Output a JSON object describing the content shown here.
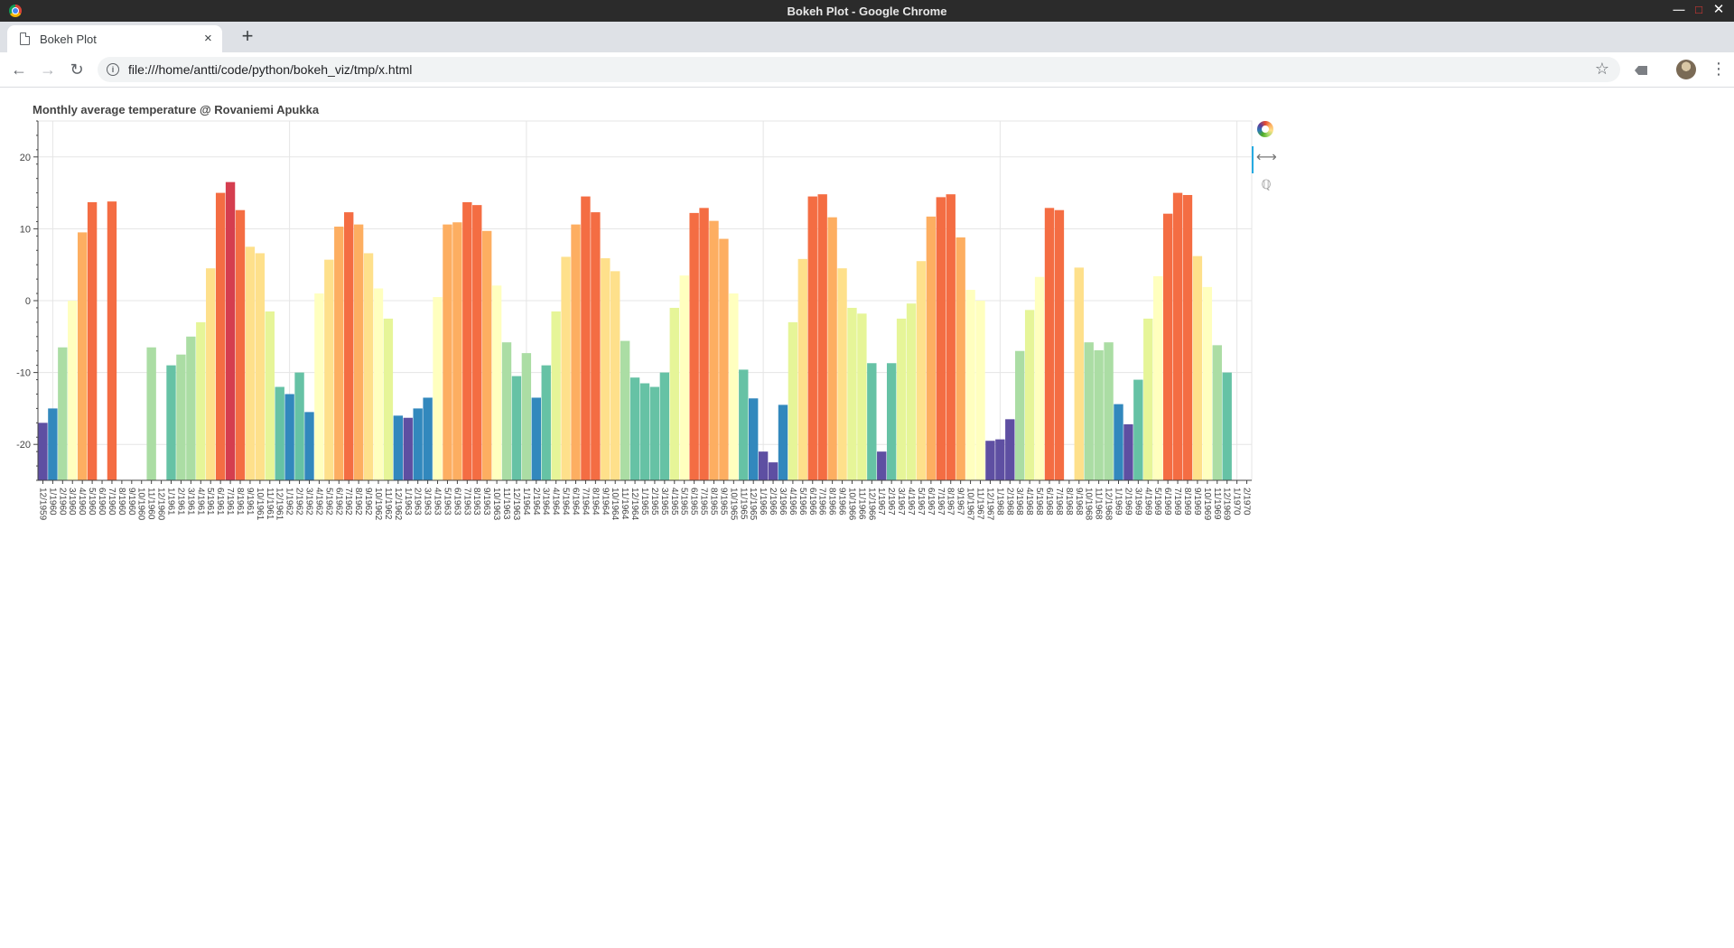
{
  "window": {
    "title": "Bokeh Plot - Google Chrome"
  },
  "tab": {
    "label": "Bokeh Plot",
    "close": "×",
    "new_tab": "+"
  },
  "toolbar": {
    "back": "←",
    "forward": "→",
    "reload": "↻",
    "url": "file:///home/antti/code/python/bokeh_viz/tmp/x.html",
    "info": "i",
    "star": "☆",
    "menu": "⋮"
  },
  "plot_tools": {
    "pan": "⟷",
    "zoom": "ℚ"
  },
  "colors": {
    "palette_spectral": [
      "#5e4fa2",
      "#3288bd",
      "#66c2a5",
      "#abdda4",
      "#e6f598",
      "#ffffbf",
      "#fee08b",
      "#fdae61",
      "#f46d43",
      "#d53e4f"
    ],
    "grid": "#e5e5e5",
    "axis": "#444444"
  },
  "chart_data": {
    "type": "bar",
    "title": "Monthly average temperature @ Rovaniemi Apukka",
    "xlabel": "",
    "ylabel": "",
    "ylim": [
      -25,
      25
    ],
    "y_ticks": [
      -20,
      -10,
      0,
      10,
      20
    ],
    "grid": true,
    "categories": [
      "12/1959",
      "1/1960",
      "2/1960",
      "3/1960",
      "4/1960",
      "5/1960",
      "6/1960",
      "7/1960",
      "8/1960",
      "9/1960",
      "10/1960",
      "11/1960",
      "12/1960",
      "1/1961",
      "2/1961",
      "3/1961",
      "4/1961",
      "5/1961",
      "6/1961",
      "7/1961",
      "8/1961",
      "9/1961",
      "10/1961",
      "11/1961",
      "12/1961",
      "1/1962",
      "2/1962",
      "3/1962",
      "4/1962",
      "5/1962",
      "6/1962",
      "7/1962",
      "8/1962",
      "9/1962",
      "10/1962",
      "11/1962",
      "12/1962",
      "1/1963",
      "2/1963",
      "3/1963",
      "4/1963",
      "5/1963",
      "6/1963",
      "7/1963",
      "8/1963",
      "9/1963",
      "10/1963",
      "11/1963",
      "12/1963",
      "1/1964",
      "2/1964",
      "3/1964",
      "4/1964",
      "5/1964",
      "6/1964",
      "7/1964",
      "8/1964",
      "9/1964",
      "10/1964",
      "11/1964",
      "12/1964",
      "1/1965",
      "2/1965",
      "3/1965",
      "4/1965",
      "5/1965",
      "6/1965",
      "7/1965",
      "8/1965",
      "9/1965",
      "10/1965",
      "11/1965",
      "12/1965",
      "1/1966",
      "2/1966",
      "3/1966",
      "4/1966",
      "5/1966",
      "6/1966",
      "7/1966",
      "8/1966",
      "9/1966",
      "10/1966",
      "11/1966",
      "12/1966",
      "1/1967",
      "2/1967",
      "3/1967",
      "4/1967",
      "5/1967",
      "6/1967",
      "7/1967",
      "8/1967",
      "9/1967",
      "10/1967",
      "11/1967",
      "12/1967",
      "1/1968",
      "2/1968",
      "3/1968",
      "4/1968",
      "5/1968",
      "6/1968",
      "7/1968",
      "8/1968",
      "9/1968",
      "10/1968",
      "11/1968",
      "12/1968",
      "1/1969",
      "2/1969",
      "3/1969",
      "4/1969",
      "5/1969",
      "6/1969",
      "7/1969",
      "8/1969",
      "9/1969",
      "10/1969",
      "11/1969",
      "12/1969",
      "1/1970",
      "2/1970"
    ],
    "values": [
      -17,
      -15,
      -6.5,
      0,
      9.5,
      13.7,
      null,
      13.8,
      null,
      null,
      null,
      -6.5,
      null,
      -9,
      -7.5,
      -5,
      -3,
      4.5,
      15,
      16.5,
      12.6,
      7.5,
      6.6,
      -1.5,
      -12,
      -13,
      -10,
      -15.5,
      1,
      5.7,
      10.3,
      12.3,
      10.6,
      6.6,
      1.7,
      -2.5,
      -16,
      -16.3,
      -15,
      -13.5,
      0.5,
      10.6,
      10.9,
      13.7,
      13.3,
      9.7,
      2.1,
      -5.8,
      -10.5,
      -7.3,
      -13.5,
      -9,
      -1.5,
      6.1,
      10.6,
      14.5,
      12.3,
      5.9,
      4.1,
      -5.6,
      -10.7,
      -11.5,
      -12,
      -10,
      -1,
      3.5,
      12.2,
      12.9,
      11.1,
      8.6,
      1,
      -9.6,
      -13.6,
      -21,
      -22.5,
      -14.5,
      -3,
      5.8,
      14.5,
      14.8,
      11.6,
      4.5,
      -1,
      -1.8,
      -8.7,
      -21,
      -8.7,
      -2.5,
      -0.4,
      5.5,
      11.7,
      14.4,
      14.8,
      8.8,
      1.5,
      0,
      -19.5,
      -19.3,
      -16.5,
      -7,
      -1.3,
      3.3,
      12.9,
      12.6,
      null,
      4.6,
      -5.8,
      -6.9,
      -5.8,
      -14.4,
      -17.2,
      -11,
      -2.5,
      3.4,
      12.1,
      15,
      14.7,
      6.2,
      1.9,
      -6.2,
      -10,
      null,
      null
    ]
  }
}
